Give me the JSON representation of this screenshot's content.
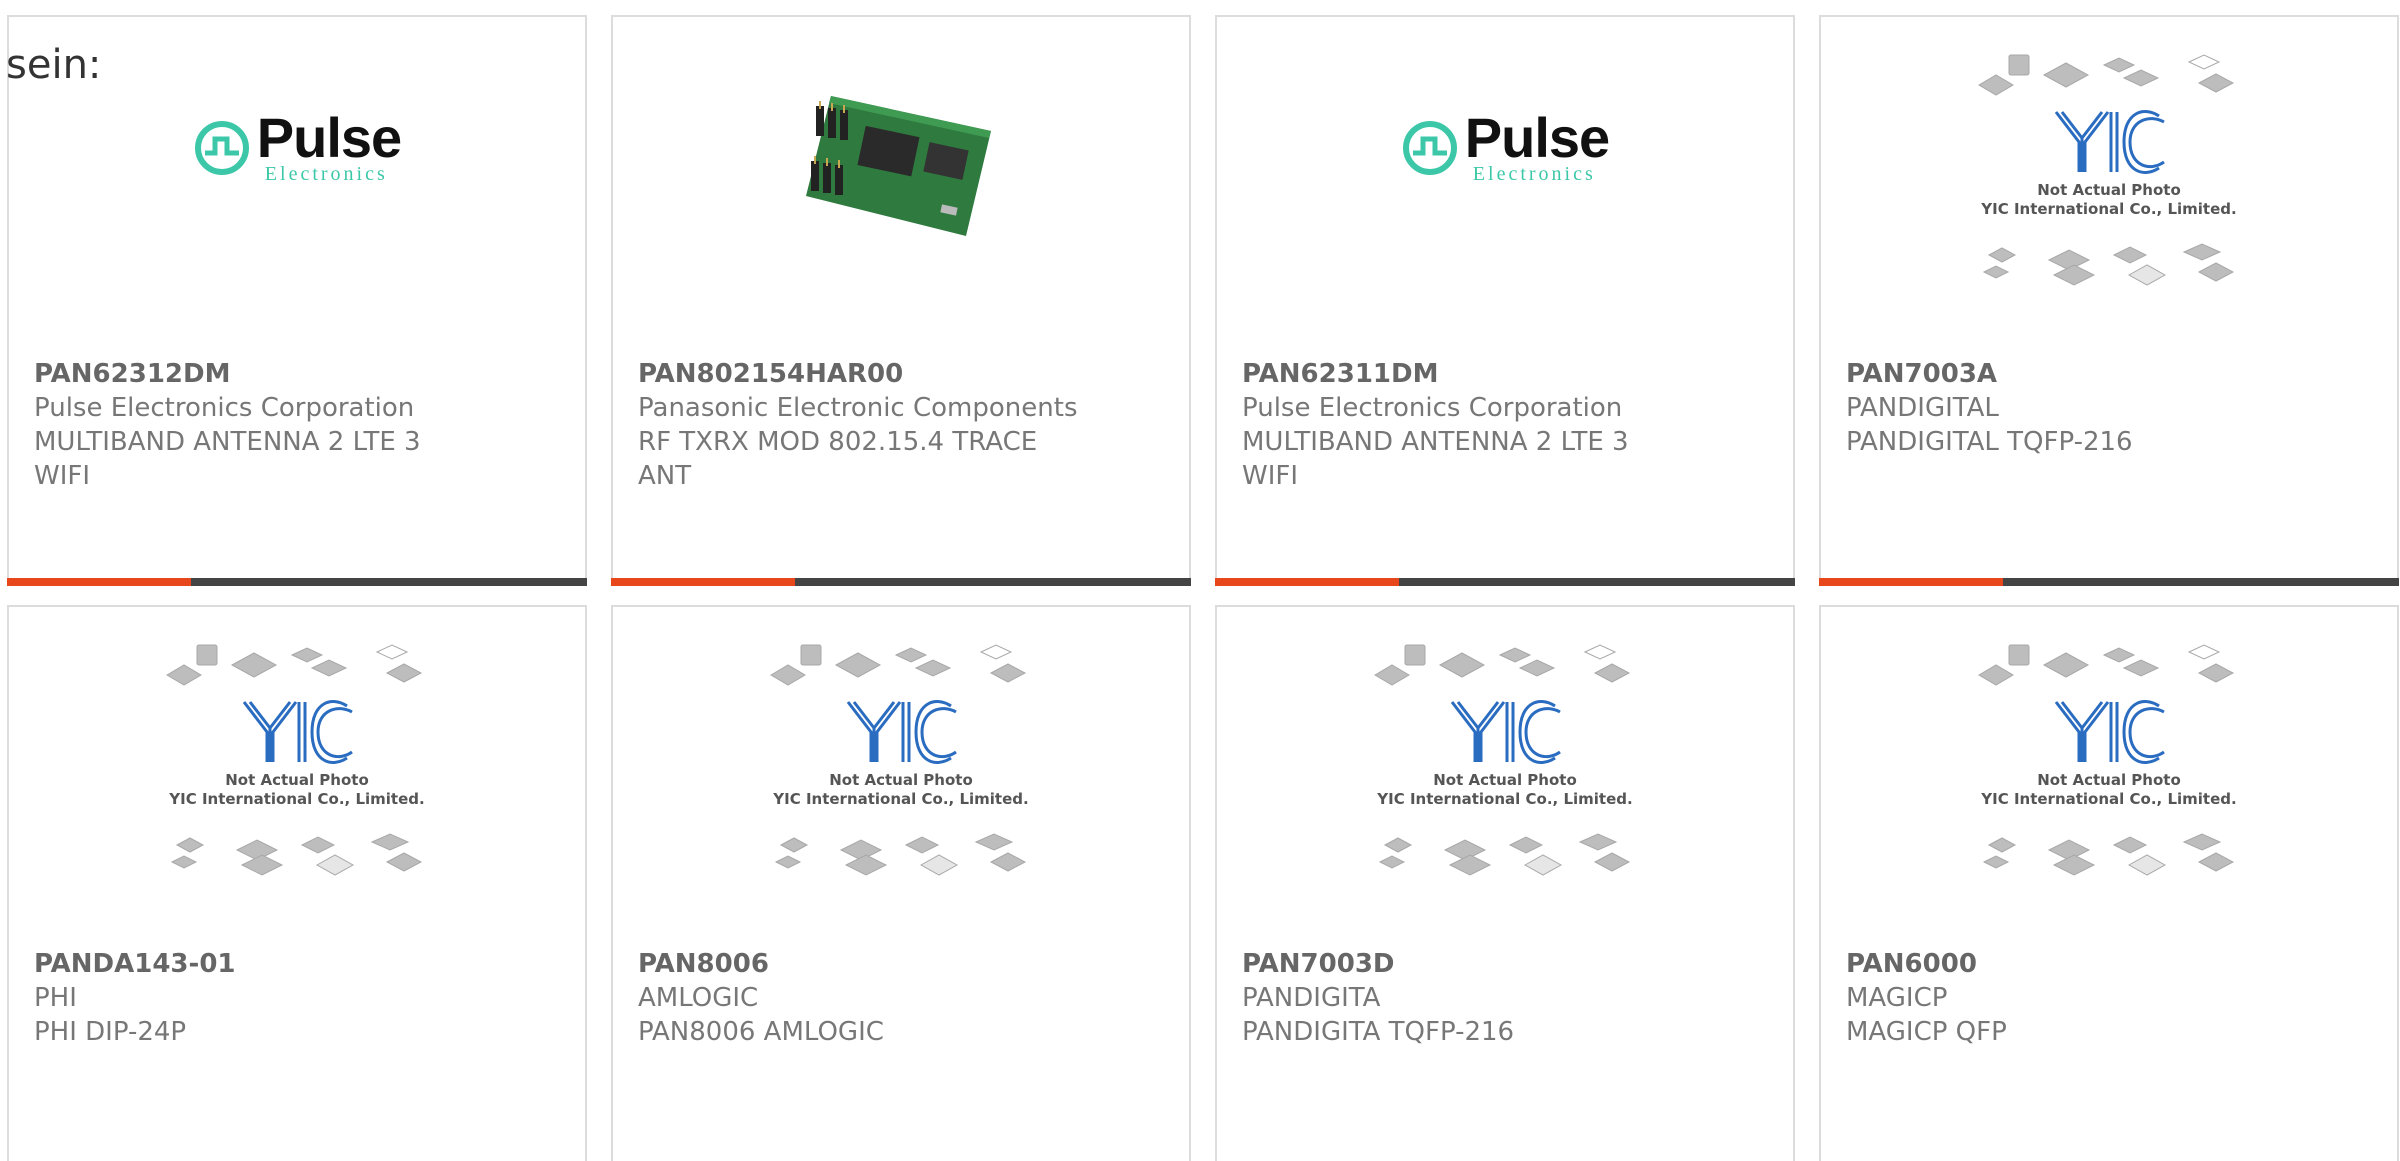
{
  "intro_text": "sein:",
  "placeholder": {
    "brand": "YIC",
    "line1": "Not Actual Photo",
    "line2": "YIC International Co., Limited."
  },
  "pulse_logo": {
    "word": "Pulse",
    "sub": "Electronics",
    "brand_color": "#3cc8a8"
  },
  "accent_color": "#e8461b",
  "products": [
    {
      "part": "PAN62312DM",
      "manufacturer": "Pulse Electronics Corporation",
      "desc1": "MULTIBAND ANTENNA 2 LTE 3",
      "desc2": "WIFI",
      "image": "pulse-logo"
    },
    {
      "part": "PAN802154HAR00",
      "manufacturer": "Panasonic Electronic Components",
      "desc1": "RF TXRX MOD 802.15.4 TRACE",
      "desc2": "ANT",
      "image": "module-photo"
    },
    {
      "part": "PAN62311DM",
      "manufacturer": "Pulse Electronics Corporation",
      "desc1": "MULTIBAND ANTENNA 2 LTE 3",
      "desc2": "WIFI",
      "image": "pulse-logo"
    },
    {
      "part": "PAN7003A",
      "manufacturer": "PANDIGITAL",
      "desc1": "PANDIGITAL TQFP-216",
      "desc2": "",
      "image": "yic-placeholder"
    },
    {
      "part": "PANDA143-01",
      "manufacturer": "PHI",
      "desc1": "PHI DIP-24P",
      "desc2": "",
      "image": "yic-placeholder"
    },
    {
      "part": "PAN8006",
      "manufacturer": "AMLOGIC",
      "desc1": "PAN8006 AMLOGIC",
      "desc2": "",
      "image": "yic-placeholder"
    },
    {
      "part": "PAN7003D",
      "manufacturer": "PANDIGITA",
      "desc1": "PANDIGITA TQFP-216",
      "desc2": "",
      "image": "yic-placeholder"
    },
    {
      "part": "PAN6000",
      "manufacturer": "MAGICP",
      "desc1": "MAGICP QFP",
      "desc2": "",
      "image": "yic-placeholder"
    }
  ]
}
